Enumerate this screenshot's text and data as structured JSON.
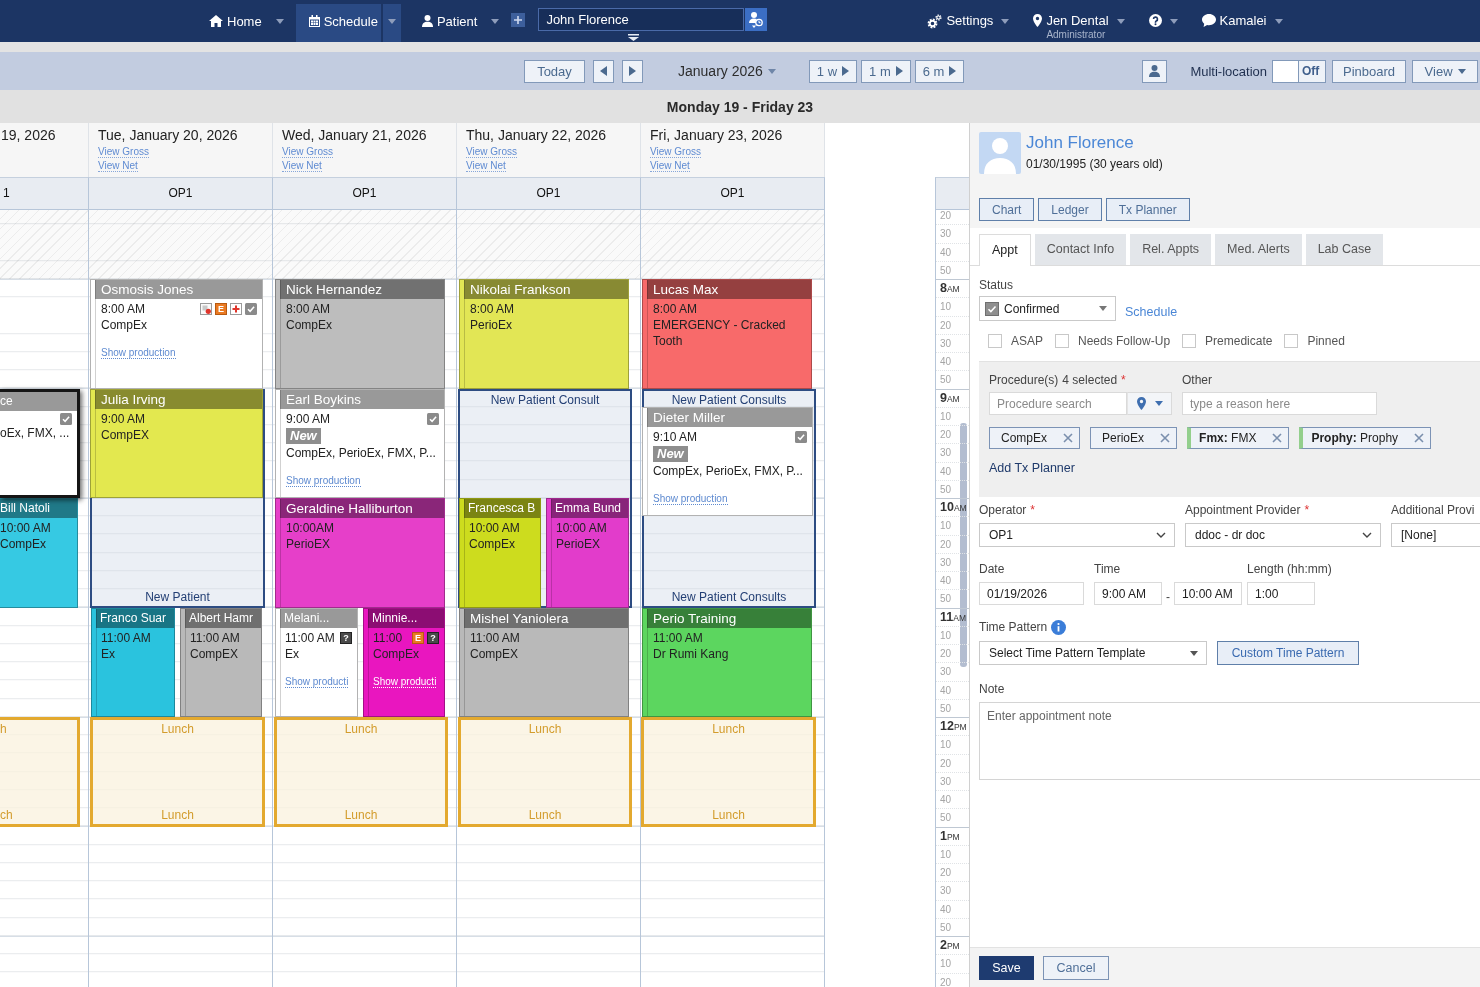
{
  "nav": {
    "items": [
      {
        "kind": "home",
        "label": "Home",
        "selected": false
      },
      {
        "kind": "schedule",
        "label": "Schedule",
        "selected": true
      },
      {
        "kind": "patient",
        "label": "Patient",
        "selected": false
      }
    ],
    "patient_search": {
      "value": "John Florence"
    },
    "right_items": [
      {
        "kind": "settings",
        "label": "Settings"
      },
      {
        "kind": "location",
        "label": "Jen Dental",
        "sublabel": "Administrator"
      },
      {
        "kind": "help"
      },
      {
        "kind": "account",
        "label": "Kamalei"
      }
    ]
  },
  "toolbar": {
    "today": "Today",
    "period": "January 2026",
    "jumps": [
      "1 w",
      "1 m",
      "6 m"
    ],
    "multi_location": {
      "label": "Multi-location",
      "on": false,
      "state_label": "Off"
    },
    "buttons": [
      {
        "label": "Pinboard",
        "kind": "plain"
      },
      {
        "label": "View",
        "kind": "menu"
      }
    ]
  },
  "range_title": "Monday 19 - Friday 23",
  "days": [
    {
      "title": "19, 2026",
      "operatory": "1",
      "appointments": [
        {
          "patient": "ce",
          "procedures": "oEx, FMX, ...",
          "color": "#ffffff",
          "confirmed": true,
          "note": false,
          "medical_alert": false,
          "selected": true
        },
        {
          "patient": "Bill Natoli",
          "time": "10:00 AM",
          "procedures": "CompEx",
          "color": "#36c9e3",
          "confirmed": false,
          "note": false,
          "medical_alert": false,
          "selected": false
        }
      ],
      "blocks": [
        {
          "kind": "lunch",
          "top_label": "h",
          "bottom_label": "ch"
        }
      ]
    },
    {
      "title": "Tue, January 20, 2026",
      "gross_link": "View Gross",
      "net_link": "View Net",
      "operatory": "OP1",
      "appointments": [
        {
          "patient": "Osmosis Jones",
          "time": "8:00 AM",
          "procedures": "CompEx",
          "production_link": "Show production",
          "color": "#ffffff",
          "confirmed": true,
          "note": true,
          "medical_alert": true,
          "badges": [
            {
              "kind": "alert",
              "text": "E"
            }
          ],
          "selected": false
        },
        {
          "patient": "Julia Irving",
          "time": "9:00 AM",
          "procedures": "CompEX",
          "color": "#e3e84f",
          "confirmed": false,
          "note": false,
          "medical_alert": false,
          "selected": false
        },
        {
          "patient": "Franco Suar",
          "time": "11:00 AM",
          "procedures": "Ex",
          "color": "#2ac3de",
          "confirmed": false,
          "note": false,
          "medical_alert": false,
          "selected": false
        },
        {
          "patient": "Albert Hamr",
          "time": "11:00 AM",
          "procedures": "CompEX",
          "color": "#b9b9b9",
          "confirmed": false,
          "note": false,
          "medical_alert": false,
          "selected": false
        }
      ],
      "blocks": [
        {
          "kind": "template",
          "bottom_label": "New Patient"
        },
        {
          "kind": "lunch",
          "top_label": "Lunch",
          "bottom_label": "Lunch"
        }
      ]
    },
    {
      "title": "Wed, January 21, 2026",
      "gross_link": "View Gross",
      "net_link": "View Net",
      "operatory": "OP1",
      "appointments": [
        {
          "patient": "Nick Hernandez",
          "time": "8:00 AM",
          "procedures": "CompEx",
          "color": "#bdbdbd",
          "confirmed": false,
          "note": false,
          "medical_alert": false,
          "selected": false
        },
        {
          "patient": "Earl Boykins",
          "time": "9:00 AM",
          "tag": "New",
          "procedures": "CompEx, PerioEx, FMX, P...",
          "production_link": "Show production",
          "color": "#ffffff",
          "confirmed": true,
          "note": false,
          "medical_alert": false,
          "selected": false
        },
        {
          "patient": "Geraldine Halliburton",
          "time": "10:00AM",
          "procedures": "PerioEX",
          "color": "#e63fc9",
          "confirmed": false,
          "note": false,
          "medical_alert": false,
          "selected": false
        },
        {
          "patient": "Melani...",
          "time": "11:00 AM",
          "procedures": "Ex",
          "production_link": "Show producti",
          "color": "#ffffff",
          "confirmed": false,
          "note": false,
          "medical_alert": false,
          "badges": [
            {
              "kind": "unknown",
              "text": "?"
            }
          ],
          "selected": false
        },
        {
          "patient": "Minnie...",
          "time": "11:00",
          "procedures": "CompEx",
          "production_link": "Show producti",
          "color": "#e916bf",
          "confirmed": false,
          "note": false,
          "medical_alert": false,
          "badges": [
            {
              "kind": "alert",
              "text": "E"
            },
            {
              "kind": "unknown",
              "text": "?"
            }
          ],
          "selected": false
        }
      ],
      "blocks": [
        {
          "kind": "lunch",
          "top_label": "Lunch",
          "bottom_label": "Lunch"
        }
      ]
    },
    {
      "title": "Thu, January 22, 2026",
      "gross_link": "View Gross",
      "net_link": "View Net",
      "operatory": "OP1",
      "appointments": [
        {
          "patient": "Nikolai Frankson",
          "time": "8:00 AM",
          "procedures": "PerioEx",
          "color": "#e2e655",
          "confirmed": false,
          "note": false,
          "medical_alert": false,
          "selected": false
        },
        {
          "patient": "Francesca B",
          "time": "10:00 AM",
          "procedures": "CompEx",
          "color": "#cddc1e",
          "confirmed": false,
          "note": false,
          "medical_alert": false,
          "selected": false
        },
        {
          "patient": "Emma Bund",
          "time": "10:00 AM",
          "procedures": "PerioEX",
          "color": "#e23ccb",
          "confirmed": false,
          "note": false,
          "medical_alert": false,
          "selected": false
        },
        {
          "patient": "Mishel Yaniolera",
          "time": "11:00 AM",
          "procedures": "CompEX",
          "color": "#b9b9b9",
          "confirmed": false,
          "note": false,
          "medical_alert": false,
          "selected": false
        }
      ],
      "blocks": [
        {
          "kind": "template",
          "top_label": "New Patient Consult"
        },
        {
          "kind": "lunch",
          "top_label": "Lunch",
          "bottom_label": "Lunch"
        }
      ]
    },
    {
      "title": "Fri, January 23, 2026",
      "gross_link": "View Gross",
      "net_link": "View Net",
      "operatory": "OP1",
      "appointments": [
        {
          "patient": "Lucas Max",
          "time": "8:00 AM",
          "procedures": "EMERGENCY - Cracked Tooth",
          "color": "#f86a6a",
          "confirmed": false,
          "note": false,
          "medical_alert": false,
          "selected": false
        },
        {
          "patient": "Dieter Miller",
          "time": "9:10 AM",
          "tag": "New",
          "procedures": "CompEx, PerioEx, FMX, P...",
          "production_link": "Show production",
          "color": "#ffffff",
          "confirmed": true,
          "note": false,
          "medical_alert": false,
          "selected": false
        },
        {
          "patient": "Perio Training",
          "time": "11:00 AM",
          "procedures": "Dr Rumi Kang",
          "color": "#5cd65f",
          "confirmed": false,
          "note": false,
          "medical_alert": false,
          "selected": false
        }
      ],
      "blocks": [
        {
          "kind": "template",
          "top_label": "New Patient Consults",
          "bottom_label": "New Patient Consults"
        },
        {
          "kind": "lunch",
          "top_label": "Lunch",
          "bottom_label": "Lunch"
        }
      ]
    }
  ],
  "time_axis": [
    "20",
    "30",
    "40",
    "50",
    "**8**AM",
    "10",
    "20",
    "30",
    "40",
    "50",
    "**9**AM",
    "10",
    "20",
    "30",
    "40",
    "50",
    "**10**AM",
    "10",
    "20",
    "30",
    "40",
    "50",
    "**11**AM",
    "10",
    "20",
    "30",
    "40",
    "50",
    "**12**PM",
    "10",
    "20",
    "30",
    "40",
    "50",
    "**1**PM",
    "10",
    "20",
    "30",
    "40",
    "50",
    "**2**PM",
    "10",
    "20"
  ],
  "patient_panel": {
    "name": "John Florence",
    "birth": "01/30/1995 (30 years old)",
    "buttons": [
      "Chart",
      "Ledger",
      "Tx Planner"
    ],
    "tabs": [
      {
        "label": "Appt",
        "selected": true
      },
      {
        "label": "Contact Info",
        "selected": false
      },
      {
        "label": "Rel. Appts",
        "selected": false
      },
      {
        "label": "Med. Alerts",
        "selected": false
      },
      {
        "label": "Lab Case",
        "selected": false
      }
    ],
    "status": {
      "label": "Status",
      "value": "Confirmed",
      "link": "Schedule"
    },
    "options": [
      {
        "label": "ASAP",
        "checked": false
      },
      {
        "label": "Needs Follow-Up",
        "checked": false
      },
      {
        "label": "Premedicate",
        "checked": false
      },
      {
        "label": "Pinned",
        "checked": false
      }
    ],
    "procedures": {
      "label": "Procedure(s)",
      "count": "4 selected",
      "required_mark": "*",
      "search_placeholder": "Procedure search",
      "other_label": "Other",
      "other_placeholder": "type a reason here",
      "tags": [
        {
          "text": "CompEx",
          "kind": "procedure"
        },
        {
          "text": "PerioEx",
          "kind": "procedure"
        },
        {
          "text": "**Fmx:** FMX",
          "kind": "planned"
        },
        {
          "text": "**Prophy:** Prophy",
          "kind": "planned"
        }
      ],
      "add_link": "Add Tx Planner"
    },
    "provider_fields": [
      {
        "label": "Operator",
        "required_mark": "*",
        "value": "OP1"
      },
      {
        "label": "Appointment Provider",
        "required_mark": "*",
        "value": "ddoc - dr doc"
      },
      {
        "label": "Additional Provi",
        "value": "[None]"
      }
    ],
    "date": {
      "label": "Date",
      "value": "01/19/2026"
    },
    "time": {
      "label": "Time",
      "start": "9:00 AM",
      "separator": "-",
      "end": "10:00 AM"
    },
    "length": {
      "label": "Length (hh:mm)",
      "value": "1:00"
    },
    "time_pattern": {
      "label": "Time Pattern",
      "value": "Select Time Pattern Template",
      "button": "Custom Time Pattern"
    },
    "note": {
      "label": "Note",
      "placeholder": "Enter appointment note"
    },
    "actions": [
      {
        "label": "Save",
        "kind": "primary"
      },
      {
        "label": "Cancel",
        "kind": "secondary"
      }
    ]
  }
}
